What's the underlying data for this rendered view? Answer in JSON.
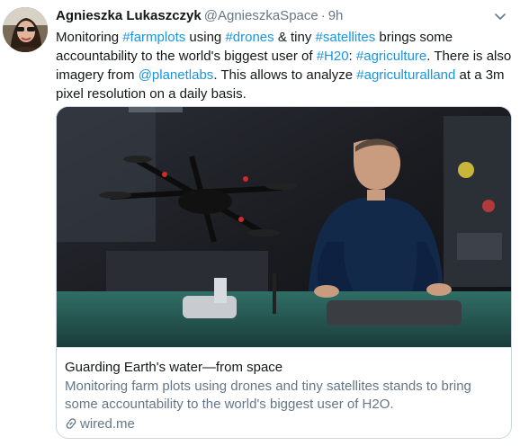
{
  "tweet": {
    "name": "Agnieszka Lukaszczyk",
    "handle": "@AgnieszkaSpace",
    "separator": "·",
    "time": "9h",
    "text_parts": [
      {
        "t": "Monitoring ",
        "link": false
      },
      {
        "t": "#farmplots",
        "link": true
      },
      {
        "t": " using ",
        "link": false
      },
      {
        "t": "#drones",
        "link": true
      },
      {
        "t": " & tiny ",
        "link": false
      },
      {
        "t": "#satellites",
        "link": true
      },
      {
        "t": " brings some accountability to the world's biggest user of ",
        "link": false
      },
      {
        "t": "#H20",
        "link": true
      },
      {
        "t": ": ",
        "link": false
      },
      {
        "t": "#agriculture",
        "link": true
      },
      {
        "t": ". There is also imagery from ",
        "link": false
      },
      {
        "t": "@planetlabs",
        "link": true
      },
      {
        "t": ". This allows to analyze ",
        "link": false
      },
      {
        "t": "#agriculturalland",
        "link": true
      },
      {
        "t": " at a 3m pixel resolution on a daily basis.",
        "link": false
      }
    ]
  },
  "card": {
    "title": "Guarding Earth's water—from space",
    "description": "Monitoring farm plots using drones and tiny satellites stands to bring some accountability to the world's biggest user of H2O.",
    "domain": "wired.me"
  },
  "icons": {
    "caret": "chevron-down-icon",
    "link": "link-icon"
  },
  "colors": {
    "link": "#1b95e0",
    "secondary_text": "#657786",
    "border": "#ccd6dd"
  }
}
